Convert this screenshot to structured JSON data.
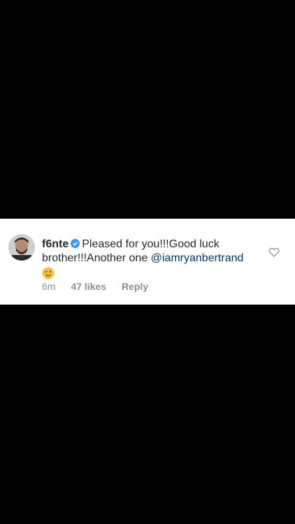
{
  "comment": {
    "username": "f6nte",
    "verified": true,
    "text": "Pleased for you!!!Good luck brother!!!Another one ",
    "mention": "@iamryanbertrand",
    "emoji": "wink-emoji",
    "time": "6m",
    "likes": "47 likes",
    "reply_label": "Reply"
  },
  "colors": {
    "background": "#000000",
    "card": "#ffffff",
    "text": "#262626",
    "mention": "#00376b",
    "meta": "#8e8e8e",
    "verified": "#3897f0"
  }
}
